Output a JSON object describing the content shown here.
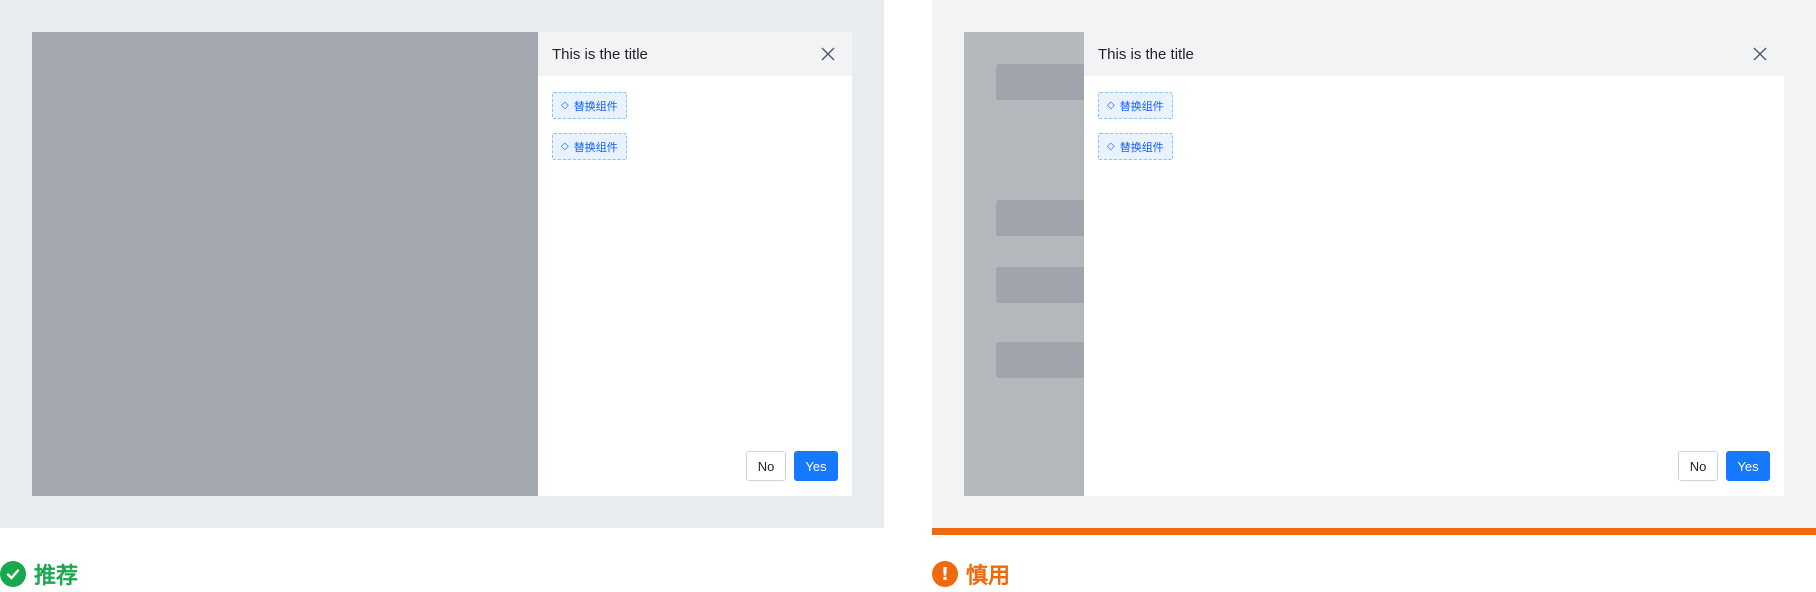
{
  "examples": [
    {
      "id": "recommended",
      "drawer": {
        "title": "This is the title",
        "chips": [
          "替换组件",
          "替换组件"
        ],
        "buttons": {
          "no": "No",
          "yes": "Yes"
        }
      },
      "verdict": {
        "label": "推荐",
        "icon": "check-circle-icon",
        "color": "#1aa84f"
      }
    },
    {
      "id": "caution",
      "drawer": {
        "title": "This is the title",
        "chips": [
          "替换组件",
          "替换组件"
        ],
        "buttons": {
          "no": "No",
          "yes": "Yes"
        }
      },
      "verdict": {
        "label": "慎用",
        "icon": "exclamation-circle-icon",
        "color": "#f0690f"
      }
    }
  ],
  "chip_icon": "◇",
  "colors": {
    "primary": "#1677ff",
    "mask": "#a3a7ae",
    "good": "#1aa84f",
    "warn": "#f0690f"
  }
}
